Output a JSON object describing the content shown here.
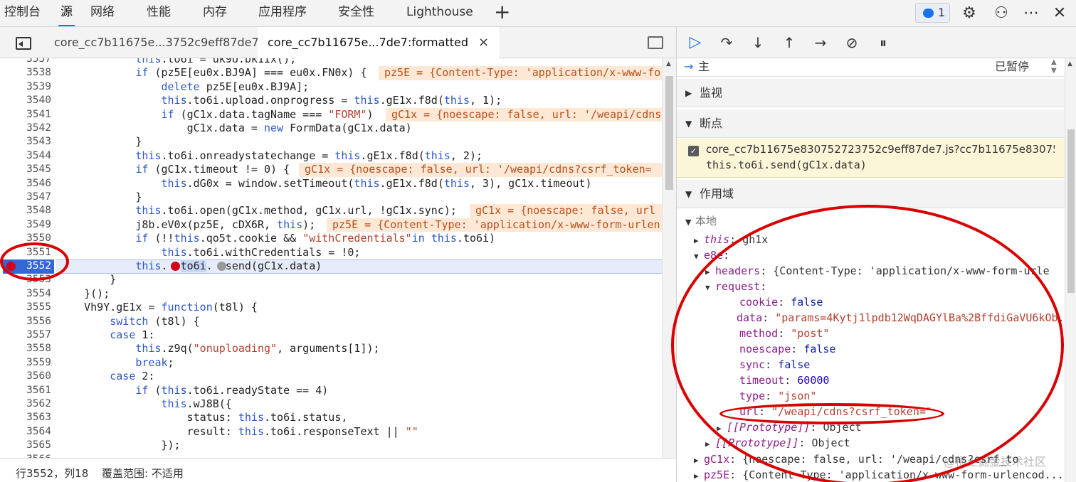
{
  "top_tabs": [
    "控制台",
    "源",
    "网络",
    "性能",
    "内存",
    "应用程序",
    "安全性",
    "Lighthouse"
  ],
  "active_top_tab": "源",
  "issues_count": "1",
  "file_tabs": [
    {
      "label": "core_cc7b11675e...3752c9eff87de7",
      "active": false
    },
    {
      "label": "core_cc7b11675e...7de7:formatted",
      "active": true,
      "close": "×"
    }
  ],
  "code_lines": [
    {
      "n": "3537",
      "t": "            this.to6i = uk9U.bk1Ix();"
    },
    {
      "n": "3538",
      "t": "            if (pz5E[eu0x.BJ9A] === eu0x.FN0x) {"
    },
    {
      "n": "3539",
      "t": "                delete pz5E[eu0x.BJ9A];"
    },
    {
      "n": "3540",
      "t": "                this.to6i.upload.onprogress = this.gE1x.f8d(this, 1);"
    },
    {
      "n": "3541",
      "t": "                if (gC1x.data.tagName === \"FORM\")"
    },
    {
      "n": "3542",
      "t": "                    gC1x.data = new FormData(gC1x.data)"
    },
    {
      "n": "3543",
      "t": "            }"
    },
    {
      "n": "3544",
      "t": "            this.to6i.onreadystatechange = this.gE1x.f8d(this, 2);"
    },
    {
      "n": "3545",
      "t": "            if (gC1x.timeout != 0) {"
    },
    {
      "n": "3546",
      "t": "                this.dG0x = window.setTimeout(this.gE1x.f8d(this, 3), gC1x.timeout)"
    },
    {
      "n": "3547",
      "t": "            }"
    },
    {
      "n": "3548",
      "t": "            this.to6i.open(gC1x.method, gC1x.url, !gC1x.sync);"
    },
    {
      "n": "3549",
      "t": "            j8b.eV0x(pz5E, cDX6R, this);"
    },
    {
      "n": "3550",
      "t": "            if (!!this.qo5t.cookie && \"withCredentials\"in this.to6i)"
    },
    {
      "n": "3551",
      "t": "                this.to6i.withCredentials = !0;"
    },
    {
      "n": "3552",
      "t": "            this.  to6i.  send(gC1x.data)"
    },
    {
      "n": "3553",
      "t": "        }"
    },
    {
      "n": "3554",
      "t": "    }();"
    },
    {
      "n": "3555",
      "t": "    Vh9Y.gE1x = function(t8l) {"
    },
    {
      "n": "3556",
      "t": "        switch (t8l) {"
    },
    {
      "n": "3557",
      "t": "        case 1:"
    },
    {
      "n": "3558",
      "t": "            this.z9q(\"onuploading\", arguments[1]);"
    },
    {
      "n": "3559",
      "t": "            break;"
    },
    {
      "n": "3560",
      "t": "        case 2:"
    },
    {
      "n": "3561",
      "t": "            if (this.to6i.readyState == 4)"
    },
    {
      "n": "3562",
      "t": "                this.wJ8B({"
    },
    {
      "n": "3563",
      "t": "                    status: this.to6i.status,"
    },
    {
      "n": "3564",
      "t": "                    result: this.to6i.responseText || \"\""
    },
    {
      "n": "3565",
      "t": "                });"
    },
    {
      "n": "3566",
      "t": ""
    }
  ],
  "inline_hints": [
    {
      "line": "3538",
      "t": "pz5E = {Content-Type: 'application/x-www-fo"
    },
    {
      "line": "3541",
      "t": "gC1x = {noescape: false, url: '/weapi/cdns"
    },
    {
      "line": "3545",
      "t": "gC1x = {noescape: false, url: '/weapi/cdns?csrf_token="
    },
    {
      "line": "3548",
      "t": "gC1x = {noescape: false, url"
    },
    {
      "line": "3549",
      "t": "pz5E = {Content-Type: 'application/x-www-form-urlen"
    }
  ],
  "status_bar": {
    "position": "行3552，列18",
    "coverage": "覆盖范围: 不适用"
  },
  "thread": {
    "name": "主",
    "state": "已暂停"
  },
  "sections": {
    "watch": "监视",
    "breakpoints": "断点",
    "scope": "作用域"
  },
  "breakpoint": {
    "file": "core_cc7b11675e830752723752c9eff87de7.js?cc7b11675e83075...",
    "code": "this.to6i.send(gC1x.data)"
  },
  "scope": {
    "local_label": "本地",
    "rows": [
      {
        "k": "this",
        "v": "gh1x"
      },
      {
        "k": "e8e",
        "v": ""
      },
      {
        "k": "headers",
        "v": "{Content-Type: 'application/x-www-form-urle"
      },
      {
        "k": "request",
        "v": ""
      },
      {
        "k": "cookie",
        "v": "false"
      },
      {
        "k": "data",
        "v": "\"params=4Kytj1lpdb12WqDAGYlBa%2BffdiGaVU6kOb..."
      },
      {
        "k": "method",
        "v": "\"post\""
      },
      {
        "k": "noescape",
        "v": "false"
      },
      {
        "k": "sync",
        "v": "false"
      },
      {
        "k": "timeout",
        "v": "60000"
      },
      {
        "k": "type",
        "v": "\"json\""
      },
      {
        "k": "url",
        "v": "\"/weapi/cdns?csrf_token=\""
      },
      {
        "k": "[[Prototype]]",
        "v": "Object"
      },
      {
        "k": "[[Prototype]]",
        "v": "Object"
      },
      {
        "k": "gC1x",
        "v": "{noescape: false, url: '/weapi/cdns?csrf_to"
      },
      {
        "k": "pz5E",
        "v": "{Content-Type: 'application/x-www-form-urlencod..."
      }
    ]
  },
  "watermark": "@稀土掘金技术社区"
}
